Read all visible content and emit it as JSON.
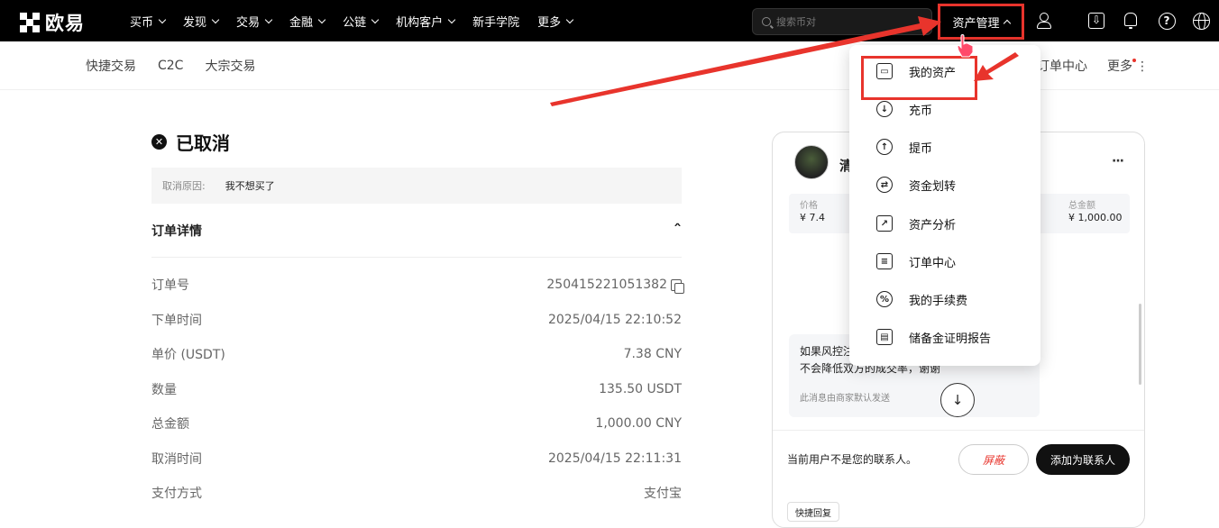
{
  "topnav": {
    "logo_text": "欧易",
    "items": [
      {
        "label": "买币"
      },
      {
        "label": "发现"
      },
      {
        "label": "交易"
      },
      {
        "label": "金融"
      },
      {
        "label": "公链"
      },
      {
        "label": "机构客户"
      },
      {
        "label": "新手学院",
        "no_chevron": true
      },
      {
        "label": "更多"
      }
    ],
    "search_placeholder": "搜索币对",
    "asset_menu_label": "资产管理",
    "download_glyph": "⇩",
    "help_glyph": "?"
  },
  "subnav": {
    "items": [
      "快捷交易",
      "C2C",
      "大宗交易"
    ],
    "right_items": [
      "订单中心",
      "更多"
    ],
    "more_glyph": "⋮"
  },
  "order": {
    "status_glyph": "✕",
    "status": "已取消",
    "cancel_reason_label": "取消原因:",
    "cancel_reason": "我不想买了",
    "details_title": "订单详情",
    "collapse_glyph": "ˆ",
    "rows": [
      {
        "key": "订单号",
        "value": "250415221051382",
        "copy": true
      },
      {
        "key": "下单时间",
        "value": "2025/04/15 22:10:52"
      },
      {
        "key": "单价 (USDT)",
        "value": "7.38 CNY"
      },
      {
        "key": "数量",
        "value": "135.50 USDT"
      },
      {
        "key": "总金额",
        "value": "1,000.00 CNY"
      },
      {
        "key": "取消时间",
        "value": "2025/04/15 22:11:31"
      },
      {
        "key": "支付方式",
        "value": "支付宝"
      }
    ]
  },
  "chat": {
    "merchant_name": "清",
    "more_glyph": "···",
    "price_label": "价格",
    "price_value": "¥ 7.4",
    "total_label": "总金额",
    "total_value": "¥ 1,000.00",
    "message_line1": "如果风控注",
    "message_line2": "不会降低双方的成交率，谢谢",
    "message_hint": "此消息由商家默认发送",
    "scroll_glyph": "↓",
    "contact_notice": "当前用户不是您的联系人。",
    "block_label": "屏蔽",
    "add_contact_label": "添加为联系人",
    "quick_reply_label": "快捷回复"
  },
  "dropdown": {
    "items": [
      {
        "label": "我的资产",
        "icon": "wallet-icon",
        "glyph": "▭"
      },
      {
        "label": "充币",
        "icon": "deposit-icon",
        "glyph": "↓"
      },
      {
        "label": "提币",
        "icon": "withdraw-icon",
        "glyph": "↑"
      },
      {
        "label": "资金划转",
        "icon": "transfer-icon",
        "glyph": "⇄"
      },
      {
        "label": "资产分析",
        "icon": "analysis-icon",
        "glyph": "↗"
      },
      {
        "label": "订单中心",
        "icon": "order-icon",
        "glyph": "≡"
      },
      {
        "label": "我的手续费",
        "icon": "fee-icon",
        "glyph": "%"
      },
      {
        "label": "储备金证明报告",
        "icon": "reserve-icon",
        "glyph": "▤"
      }
    ]
  },
  "colors": {
    "accent_red": "#e8342c",
    "nav_bg": "#000000"
  }
}
